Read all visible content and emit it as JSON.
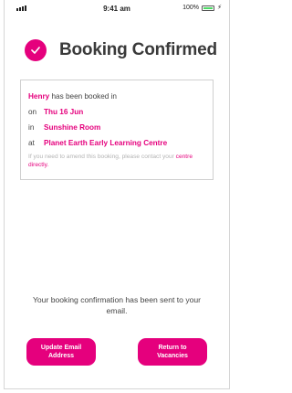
{
  "status_bar": {
    "time": "9:41 am",
    "battery": "100%"
  },
  "header": {
    "title": "Booking Confirmed"
  },
  "booking": {
    "child_name": "Henry",
    "booked_text": "has been booked in",
    "on_label": "on",
    "date": "Thu 16 Jun",
    "in_label": "in",
    "room": "Sunshine Room",
    "at_label": "at",
    "centre": "Planet Earth Early Learning Centre",
    "note_text": "If you need to amend this booking, please contact your",
    "note_link": "centre directly."
  },
  "confirmation_message": "Your booking confirmation has been sent to your email.",
  "buttons": {
    "update_email": "Update Email\nAddress",
    "return_vacancies": "Return to\nVacancies"
  },
  "colors": {
    "accent": "#e5007d",
    "battery": "#4cd964"
  }
}
